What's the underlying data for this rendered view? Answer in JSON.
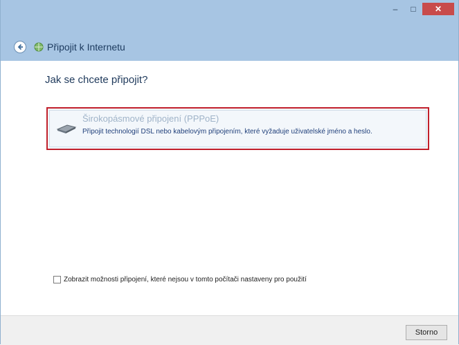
{
  "window": {
    "title": "Připojit k Internetu"
  },
  "titlebar": {
    "minimize_icon": "minimize-icon",
    "maximize_icon": "maximize-icon",
    "close_icon": "close-icon",
    "close_symbol": "✕",
    "minimize_symbol": "–",
    "maximize_symbol": "□"
  },
  "main": {
    "question": "Jak se chcete připojit?",
    "option": {
      "title": "Širokopásmové připojení (PPPoE)",
      "description": "Připojit technologií DSL nebo kabelovým připojením, které vyžaduje uživatelské jméno a heslo."
    },
    "checkbox": {
      "label": "Zobrazit možnosti připojení, které nejsou v tomto počítači nastaveny pro použití",
      "checked": false
    }
  },
  "footer": {
    "cancel_label": "Storno"
  },
  "colors": {
    "titlebar": "#a7c5e3",
    "highlight_border": "#c11f2b",
    "close_button": "#c84b4b",
    "heading_text": "#1e395b"
  }
}
